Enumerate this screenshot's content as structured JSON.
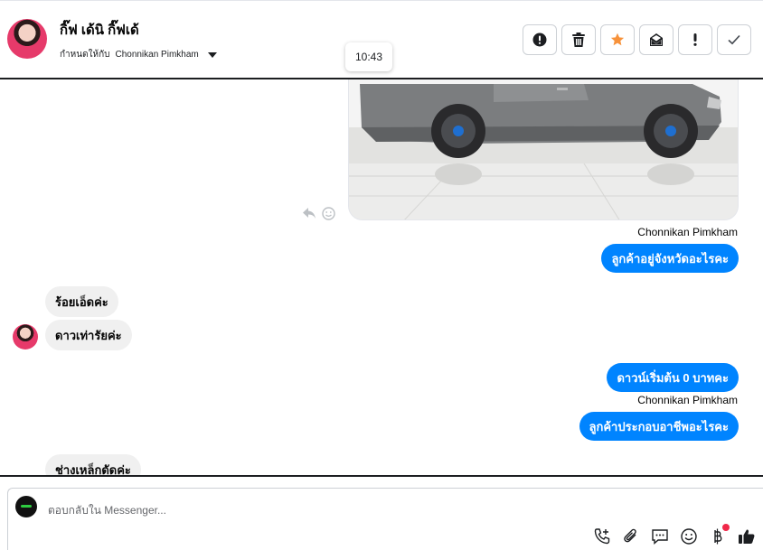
{
  "header": {
    "contact_name": "กิ๊ฟ เด้นิ กิ๊ฟเด้",
    "assign_label": "กำหนดให้กับ",
    "assignee": "Chonnikan Pimkham",
    "tooltip_time": "10:43",
    "toolbar": [
      {
        "name": "alert-button",
        "icon": "exclamation-circle-icon"
      },
      {
        "name": "delete-button",
        "icon": "trash-icon"
      },
      {
        "name": "star-button",
        "icon": "star-icon",
        "color": "#f7923b"
      },
      {
        "name": "mark-unread-button",
        "icon": "envelope-icon"
      },
      {
        "name": "spam-button",
        "icon": "exclamation-icon"
      },
      {
        "name": "done-button",
        "icon": "check-icon"
      }
    ]
  },
  "thread": {
    "sender_1": "Chonnikan Pimkham",
    "out_1": "ลูกค้าอยู่จังหวัดอะไรคะ",
    "in_1": "ร้อยเอ็ดค่ะ",
    "in_2": "ดาวเท่ารัยค่ะ",
    "out_2": "ดาวน์เริ่มต้น 0 บาทคะ",
    "sender_2": "Chonnikan Pimkham",
    "out_3": "ลูกค้าประกอบอาชีพอะไรคะ",
    "in_3": "ช่างเหล็กดัดค่ะ"
  },
  "composer": {
    "placeholder": "ตอบกลับใน Messenger...",
    "tools": [
      "call-add-icon",
      "paperclip-icon",
      "saved-replies-icon",
      "emoji-icon",
      "baht-icon",
      "thumbs-up-icon"
    ]
  },
  "colors": {
    "accent": "#0084ff",
    "incoming_bubble": "#f0f0f0",
    "star": "#f7923b",
    "notification": "#f02849"
  }
}
